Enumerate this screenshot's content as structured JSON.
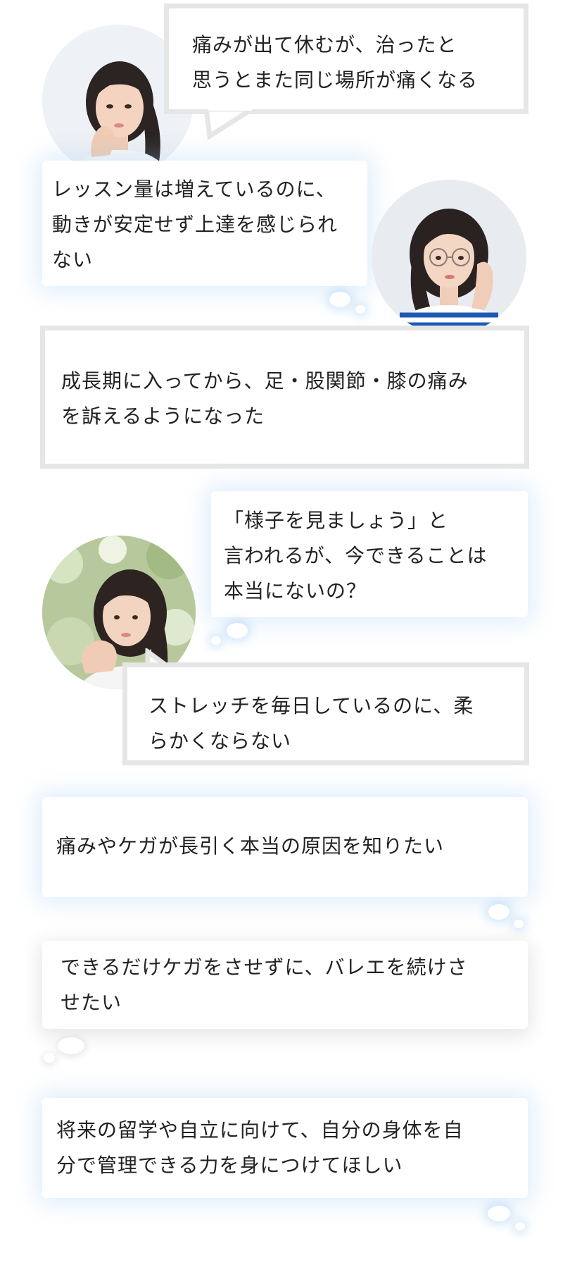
{
  "concerns": [
    "痛みが出て休むが、治ったと\n思うとまた同じ場所が痛くなる",
    "レッスン量は増えているのに、\n動きが安定せず上達を感じられ\nない",
    "成長期に入ってから、足・股関節・膝の痛み\nを訴えるようになった",
    "「様子を見ましょう」と\n言われるが、今できることは\n本当にないの？",
    "ストレッチを毎日しているのに、柔\nらかくならない"
  ],
  "wishes": [
    "痛みやケガが長引く本当の原因を知りたい",
    "できるだけケガをさせずに、バレエを続けさ\nせたい",
    "将来の留学や自立に向けて、自分の身体を自\n分で管理できる力を身につけてほしい"
  ],
  "colors": {
    "frame_border": "#e6e6e6",
    "glow": "#96c8f5",
    "text": "#222222"
  }
}
